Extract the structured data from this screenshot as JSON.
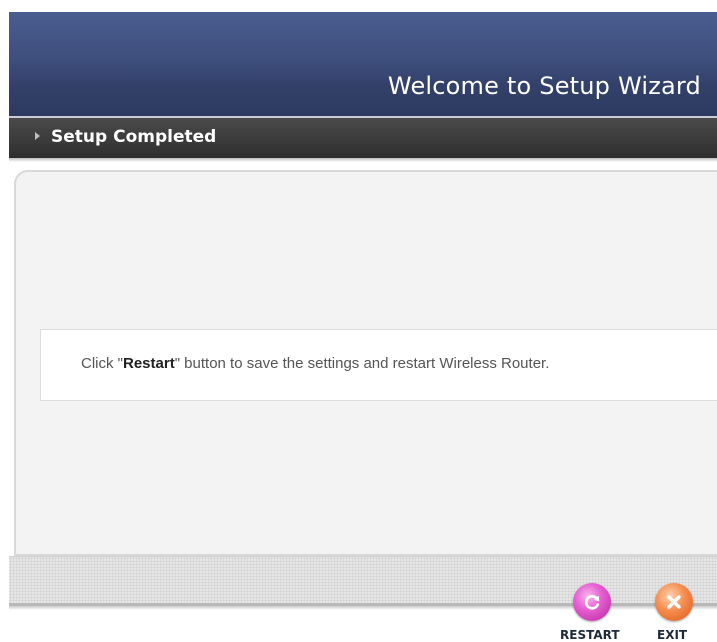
{
  "header": {
    "title": "Welcome to Setup Wizard"
  },
  "section": {
    "title": "Setup Completed"
  },
  "message": {
    "prefix": "Click \"",
    "emphasis": "Restart",
    "suffix": "\" button to save the settings and restart Wireless Router."
  },
  "actions": {
    "restart_label": "RESTART",
    "exit_label": "EXIT",
    "restart_icon": "refresh-icon",
    "exit_icon": "close-icon"
  },
  "colors": {
    "banner": "#3e4f7e",
    "section_bar": "#3a3a3a",
    "restart": "#e65fd2",
    "exit": "#f58b4c"
  }
}
